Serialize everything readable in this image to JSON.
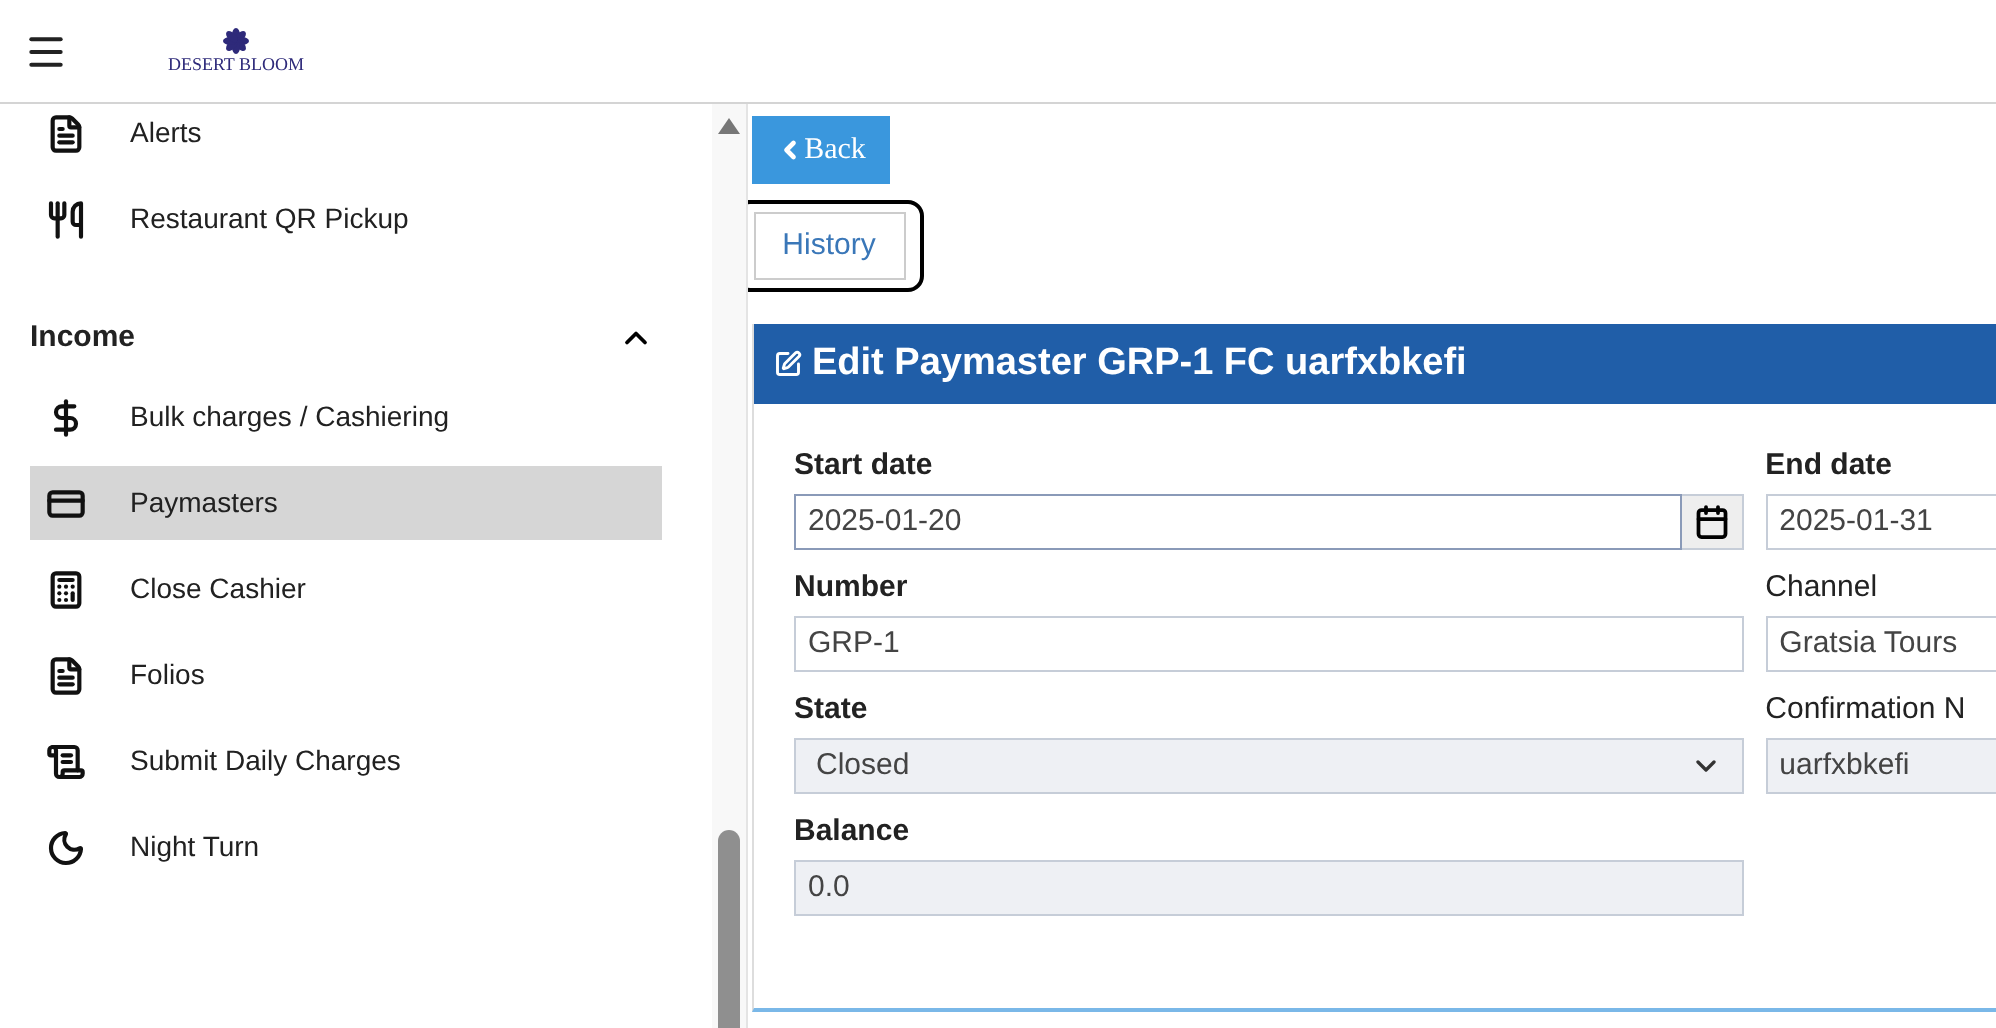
{
  "header": {
    "logo_text": "DESERT BLOOM"
  },
  "sidebar": {
    "items": [
      {
        "label": "Alerts",
        "selected": false
      },
      {
        "label": "Restaurant QR Pickup",
        "selected": false
      }
    ],
    "section": {
      "title": "Income",
      "expanded": true,
      "items": [
        {
          "label": "Bulk charges / Cashiering",
          "selected": false
        },
        {
          "label": "Paymasters",
          "selected": true
        },
        {
          "label": "Close Cashier",
          "selected": false
        },
        {
          "label": "Folios",
          "selected": false
        },
        {
          "label": "Submit Daily Charges",
          "selected": false
        },
        {
          "label": "Night Turn",
          "selected": false
        }
      ]
    }
  },
  "back_button": "Back",
  "history_button": {
    "label": "History",
    "focused": true
  },
  "form": {
    "title": "Edit Paymaster GRP-1 FC uarfxbkefi",
    "left_fields": [
      {
        "label": "Start date",
        "value": "2025-01-20",
        "kind": "date",
        "required": true,
        "disabled": false
      },
      {
        "label": "Number",
        "value": "GRP-1",
        "kind": "text",
        "required": true,
        "disabled": false
      },
      {
        "label": "State",
        "value": "Closed",
        "kind": "select",
        "required": true,
        "disabled": true
      },
      {
        "label": "Balance",
        "value": "0.0",
        "kind": "text",
        "required": true,
        "disabled": true
      }
    ],
    "right_fields": [
      {
        "label": "End date",
        "value": "2025-01-31",
        "kind": "text",
        "required": true,
        "disabled": false
      },
      {
        "label": "Channel",
        "value": "Gratsia Tours",
        "kind": "text",
        "required": false,
        "disabled": false
      },
      {
        "label": "Confirmation N",
        "value": "uarfxbkefi",
        "kind": "text",
        "required": false,
        "disabled": true
      }
    ]
  }
}
